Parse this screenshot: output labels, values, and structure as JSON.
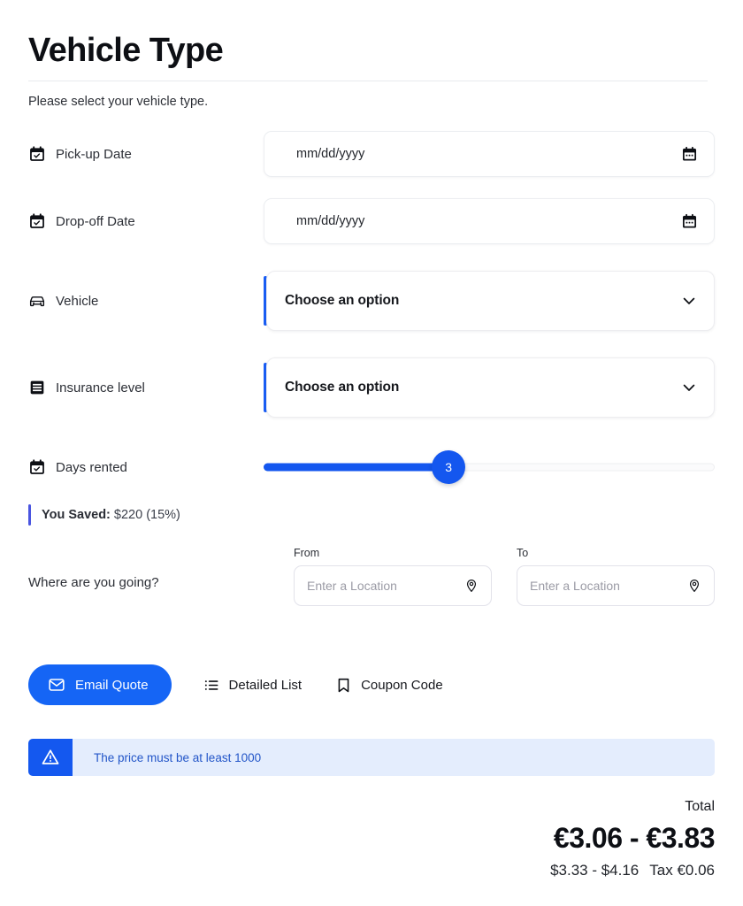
{
  "header": {
    "title": "Vehicle Type",
    "subtitle": "Please select your vehicle type."
  },
  "fields": {
    "pickup": {
      "icon": "calendar-check-icon",
      "label": "Pick-up Date",
      "placeholder": "mm/dd/yyyy",
      "value": "",
      "trailing_icon": "calendar-icon"
    },
    "dropoff": {
      "icon": "calendar-check-icon",
      "label": "Drop-off Date",
      "placeholder": "mm/dd/yyyy",
      "value": "",
      "trailing_icon": "calendar-icon"
    },
    "vehicle": {
      "icon": "car-icon",
      "label": "Vehicle",
      "selected": "Choose an option",
      "trailing_icon": "chevron-down-icon",
      "accent_color": "#1a5ef5"
    },
    "insurance": {
      "icon": "document-lines-icon",
      "label": "Insurance level",
      "selected": "Choose an option",
      "trailing_icon": "chevron-down-icon",
      "accent_color": "#1a5ef5"
    },
    "days_rented": {
      "icon": "calendar-check-icon",
      "label": "Days rented",
      "value": "3",
      "fill_percent": 41,
      "track_color": "#1457ef"
    }
  },
  "saved_note": {
    "bold_prefix": "You Saved:",
    "text": "$220 (15%)",
    "bar_color": "#4a55e0"
  },
  "location": {
    "question": "Where are you going?",
    "from": {
      "label": "From",
      "placeholder": "Enter a Location",
      "value": "",
      "icon": "map-pin-icon"
    },
    "to": {
      "label": "To",
      "placeholder": "Enter a Location",
      "value": "",
      "icon": "map-pin-icon"
    }
  },
  "actions": {
    "email_quote": {
      "label": "Email Quote",
      "icon": "envelope-icon",
      "color": "#1565f5"
    },
    "detailed_list": {
      "label": "Detailed List",
      "icon": "list-icon"
    },
    "coupon_code": {
      "label": "Coupon Code",
      "icon": "bookmark-icon"
    }
  },
  "alert": {
    "icon": "warning-triangle-icon",
    "message": "The price must be at least 1000",
    "icon_bg": "#1458ef",
    "bg": "#e4edfd",
    "text_color": "#2255c8"
  },
  "totals": {
    "label": "Total",
    "range": "€3.06 - €3.83",
    "secondary_range": "$3.33 - $4.16",
    "tax": "Tax €0.06"
  }
}
